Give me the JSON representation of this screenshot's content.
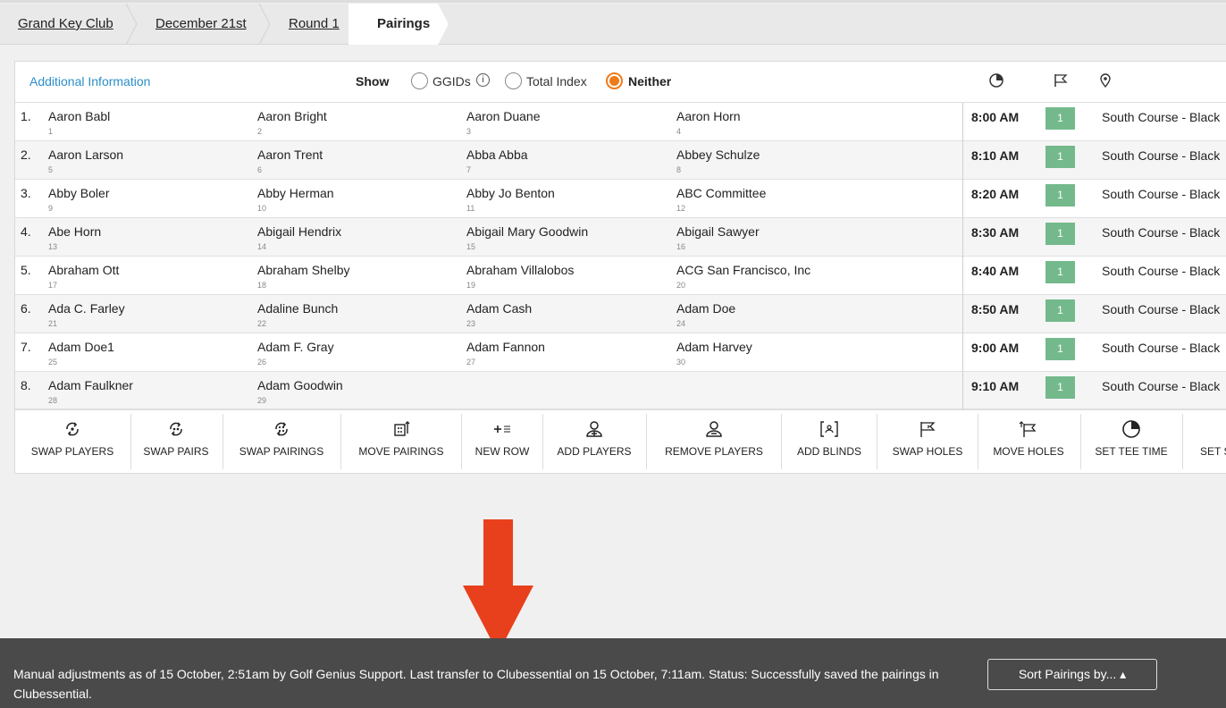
{
  "breadcrumb": {
    "items": [
      {
        "label": "Grand Key Club"
      },
      {
        "label": "December 21st"
      },
      {
        "label": "Round 1"
      },
      {
        "label": "Pairings"
      }
    ]
  },
  "header": {
    "additional_info": "Additional Information",
    "show_label": "Show",
    "options": [
      {
        "label": "GGIDs",
        "selected": false
      },
      {
        "label": "Total Index",
        "selected": false
      },
      {
        "label": "Neither",
        "selected": true
      }
    ],
    "icons": [
      "tee-time-icon",
      "flag-icon",
      "location-pin-icon"
    ]
  },
  "pairings": [
    {
      "num": "1.",
      "players": [
        {
          "name": "Aaron Babl",
          "id": "1"
        },
        {
          "name": "Aaron Bright",
          "id": "2"
        },
        {
          "name": "Aaron Duane",
          "id": "3"
        },
        {
          "name": "Aaron Horn",
          "id": "4"
        }
      ],
      "time": "8:00 AM",
      "hole": "1",
      "course": "South Course - Black"
    },
    {
      "num": "2.",
      "players": [
        {
          "name": "Aaron Larson",
          "id": "5"
        },
        {
          "name": "Aaron Trent",
          "id": "6"
        },
        {
          "name": "Abba Abba",
          "id": "7"
        },
        {
          "name": "Abbey Schulze",
          "id": "8"
        }
      ],
      "time": "8:10 AM",
      "hole": "1",
      "course": "South Course - Black"
    },
    {
      "num": "3.",
      "players": [
        {
          "name": "Abby Boler",
          "id": "9"
        },
        {
          "name": "Abby Herman",
          "id": "10"
        },
        {
          "name": "Abby Jo Benton",
          "id": "11"
        },
        {
          "name": "ABC Committee",
          "id": "12"
        }
      ],
      "time": "8:20 AM",
      "hole": "1",
      "course": "South Course - Black"
    },
    {
      "num": "4.",
      "players": [
        {
          "name": "Abe Horn",
          "id": "13"
        },
        {
          "name": "Abigail Hendrix",
          "id": "14"
        },
        {
          "name": "Abigail Mary Goodwin",
          "id": "15"
        },
        {
          "name": "Abigail Sawyer",
          "id": "16"
        }
      ],
      "time": "8:30 AM",
      "hole": "1",
      "course": "South Course - Black"
    },
    {
      "num": "5.",
      "players": [
        {
          "name": "Abraham Ott",
          "id": "17"
        },
        {
          "name": "Abraham Shelby",
          "id": "18"
        },
        {
          "name": "Abraham Villalobos",
          "id": "19"
        },
        {
          "name": "ACG San Francisco, Inc",
          "id": "20"
        }
      ],
      "time": "8:40 AM",
      "hole": "1",
      "course": "South Course - Black"
    },
    {
      "num": "6.",
      "players": [
        {
          "name": "Ada C. Farley",
          "id": "21"
        },
        {
          "name": "Adaline Bunch",
          "id": "22"
        },
        {
          "name": "Adam Cash",
          "id": "23"
        },
        {
          "name": "Adam Doe",
          "id": "24"
        }
      ],
      "time": "8:50 AM",
      "hole": "1",
      "course": "South Course - Black"
    },
    {
      "num": "7.",
      "players": [
        {
          "name": "Adam Doe1",
          "id": "25"
        },
        {
          "name": "Adam F. Gray",
          "id": "26"
        },
        {
          "name": "Adam Fannon",
          "id": "27"
        },
        {
          "name": "Adam Harvey",
          "id": "30"
        }
      ],
      "time": "9:00 AM",
      "hole": "1",
      "course": "South Course - Black"
    },
    {
      "num": "8.",
      "players": [
        {
          "name": "Adam Faulkner",
          "id": "28"
        },
        {
          "name": "Adam Goodwin",
          "id": "29"
        }
      ],
      "time": "9:10 AM",
      "hole": "1",
      "course": "South Course - Black"
    }
  ],
  "toolbar": [
    {
      "label": "SWAP PLAYERS",
      "icon": "swap-players-icon"
    },
    {
      "label": "SWAP PAIRS",
      "icon": "swap-pairs-icon"
    },
    {
      "label": "SWAP PAIRINGS",
      "icon": "swap-pairings-icon"
    },
    {
      "label": "MOVE PAIRINGS",
      "icon": "move-pairings-icon"
    },
    {
      "label": "NEW ROW",
      "icon": "new-row-icon"
    },
    {
      "label": "ADD PLAYERS",
      "icon": "add-players-icon"
    },
    {
      "label": "REMOVE PLAYERS",
      "icon": "remove-players-icon"
    },
    {
      "label": "ADD BLINDS",
      "icon": "add-blinds-icon"
    },
    {
      "label": "SWAP HOLES",
      "icon": "swap-holes-icon"
    },
    {
      "label": "MOVE HOLES",
      "icon": "move-holes-icon"
    },
    {
      "label": "SET TEE TIME",
      "icon": "set-tee-time-icon"
    },
    {
      "label": "SET S",
      "icon": "set-icon"
    }
  ],
  "footer": {
    "status": "Manual adjustments as of 15 October, 2:51am by Golf Genius Support. Last transfer to Clubessential on 15 October, 7:11am. Status: Successfully saved the pairings in Clubessential.",
    "sort_button": "Sort Pairings by... ▴"
  },
  "colors": {
    "accent_orange": "#f07a1a",
    "link_blue": "#2b8fc8",
    "hole_green": "#74b98c",
    "arrow_red": "#e8401c",
    "footer_bg": "#4a4a4a"
  }
}
